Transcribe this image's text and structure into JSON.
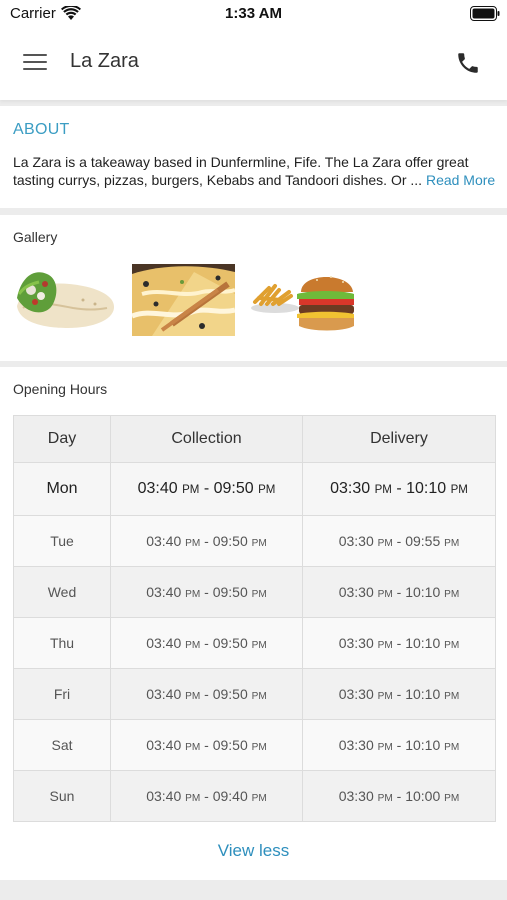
{
  "status_bar": {
    "carrier": "Carrier",
    "time": "1:33 AM",
    "wifi_icon": "wifi-icon",
    "battery_icon": "battery-icon"
  },
  "header": {
    "menu_icon": "hamburger-menu-icon",
    "title": "La Zara",
    "phone_icon": "phone-icon"
  },
  "about": {
    "heading": "ABOUT",
    "text": "La Zara is a takeaway based in Dunfermline, Fife. The La Zara offer great tasting currys, pizzas, burgers, Kebabs and Tandoori dishes. Or ... ",
    "read_more": "Read More"
  },
  "gallery": {
    "label": "Gallery",
    "images": [
      {
        "name": "wrap"
      },
      {
        "name": "pizza"
      },
      {
        "name": "burger-and-chips"
      }
    ]
  },
  "opening_hours": {
    "label": "Opening Hours",
    "columns": [
      "Day",
      "Collection",
      "Delivery"
    ],
    "rows": [
      {
        "day": "Mon",
        "col_start": "03:40",
        "col_start_ampm": "PM",
        "col_end": "09:50",
        "col_end_ampm": "PM",
        "del_start": "03:30",
        "del_start_ampm": "PM",
        "del_end": "10:10",
        "del_end_ampm": "PM"
      },
      {
        "day": "Tue",
        "col_start": "03:40",
        "col_start_ampm": "PM",
        "col_end": "09:50",
        "col_end_ampm": "PM",
        "del_start": "03:30",
        "del_start_ampm": "PM",
        "del_end": "09:55",
        "del_end_ampm": "PM"
      },
      {
        "day": "Wed",
        "col_start": "03:40",
        "col_start_ampm": "PM",
        "col_end": "09:50",
        "col_end_ampm": "PM",
        "del_start": "03:30",
        "del_start_ampm": "PM",
        "del_end": "10:10",
        "del_end_ampm": "PM"
      },
      {
        "day": "Thu",
        "col_start": "03:40",
        "col_start_ampm": "PM",
        "col_end": "09:50",
        "col_end_ampm": "PM",
        "del_start": "03:30",
        "del_start_ampm": "PM",
        "del_end": "10:10",
        "del_end_ampm": "PM"
      },
      {
        "day": "Fri",
        "col_start": "03:40",
        "col_start_ampm": "PM",
        "col_end": "09:50",
        "col_end_ampm": "PM",
        "del_start": "03:30",
        "del_start_ampm": "PM",
        "del_end": "10:10",
        "del_end_ampm": "PM"
      },
      {
        "day": "Sat",
        "col_start": "03:40",
        "col_start_ampm": "PM",
        "col_end": "09:50",
        "col_end_ampm": "PM",
        "del_start": "03:30",
        "del_start_ampm": "PM",
        "del_end": "10:10",
        "del_end_ampm": "PM"
      },
      {
        "day": "Sun",
        "col_start": "03:40",
        "col_start_ampm": "PM",
        "col_end": "09:40",
        "col_end_ampm": "PM",
        "del_start": "03:30",
        "del_start_ampm": "PM",
        "del_end": "10:00",
        "del_end_ampm": "PM"
      }
    ],
    "separator": " - ",
    "view_less": "View less"
  }
}
